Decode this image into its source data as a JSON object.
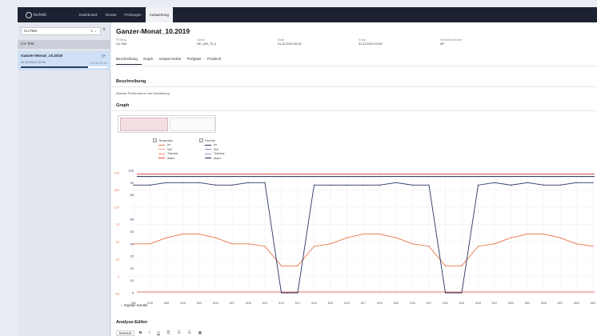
{
  "topbar": {
    "logo_text": "technik",
    "nav": [
      {
        "label": "Dashboard",
        "active": false
      },
      {
        "label": "Geräte",
        "active": false
      },
      {
        "label": "Prüfungen",
        "active": false
      },
      {
        "label": "Auswertung",
        "active": true
      }
    ]
  },
  "sidebar": {
    "select_value": "Co-Test",
    "group_label": "Co-Test",
    "item": {
      "title": "Ganzer-Monat_10.2019",
      "date": "01.10.2019, 00:00",
      "right_small": "540 Min 30 sec",
      "progress": 0.78
    }
  },
  "header": {
    "title": "Ganzer-Monat_10.2019",
    "meta": [
      {
        "label": "Prüfling",
        "value": "Co-Test"
      },
      {
        "label": "Gerät",
        "value": "DE_189_75_3"
      },
      {
        "label": "Start",
        "value": "01.10.2019 00:00"
      },
      {
        "label": "Ende",
        "value": "31.10.2019 23:59"
      },
      {
        "label": "Verantwortlicher",
        "value": "AP"
      }
    ],
    "tabs": [
      {
        "label": "Beschreibung",
        "active": true
      },
      {
        "label": "Graph",
        "active": false
      },
      {
        "label": "Analyse-Editor",
        "active": false
      },
      {
        "label": "Prüfgüter",
        "active": false
      },
      {
        "label": "Protokoll",
        "active": false
      }
    ]
  },
  "sections": {
    "beschreibung_title": "Beschreibung",
    "beschreibung_text": "Zwecks Performance und Darstellung",
    "graph_title": "Graph",
    "digital_label": "Digitale Kanäle",
    "editor_title": "Analyse-Editor"
  },
  "legend": {
    "temperature": {
      "title": "Temperatur",
      "items": [
        "Ist",
        "Soll",
        "Toleranz",
        "Alarm"
      ]
    },
    "humidity": {
      "title": "Feuchte",
      "items": [
        "Ist",
        "Soll",
        "Toleranz",
        "Alarm"
      ]
    }
  },
  "editor_toolbar": [
    "Normal",
    "B",
    "I",
    "U",
    "⎘",
    "☰",
    "☰",
    "▦"
  ],
  "colors": {
    "temperature": "#e8734a",
    "humidity": "#2a3563",
    "alarm_red": "#e04b3a",
    "alarm_navy": "#1d2a52",
    "nav_bg": "#1d2232"
  },
  "chart_data": {
    "type": "line",
    "x": [
      492,
      495,
      496,
      499,
      502,
      504,
      507,
      509,
      512,
      514,
      517,
      519,
      522,
      524,
      527,
      529,
      532,
      534,
      537,
      540,
      542,
      545,
      547,
      550,
      552,
      555,
      557,
      560,
      562
    ],
    "x_tick_labels": [
      "492",
      "495",
      "496",
      "499",
      "502",
      "504",
      "507",
      "509",
      "512",
      "514",
      "517",
      "519",
      "522",
      "524",
      "527",
      "529",
      "532",
      "534",
      "537",
      "540",
      "542",
      "545",
      "547",
      "550",
      "552",
      "555",
      "557",
      "560",
      "562"
    ],
    "y_left_ticks": [
      "175",
      "150",
      "125",
      "75",
      "45",
      "25",
      "0",
      "-45"
    ],
    "y_right_ticks": [
      "100",
      "90",
      "80",
      "60",
      "50",
      "40",
      "30",
      "20",
      "10",
      "0"
    ],
    "right_ylim": [
      0,
      100
    ],
    "series": [
      {
        "name": "Temperatur",
        "axis": "right",
        "values": [
          40,
          40,
          45,
          48,
          48,
          45,
          40,
          40,
          38,
          22,
          22,
          38,
          40,
          45,
          48,
          48,
          45,
          40,
          38,
          22,
          22,
          38,
          40,
          45,
          48,
          48,
          45,
          40,
          38
        ]
      },
      {
        "name": "Feuchte",
        "axis": "right",
        "values": [
          88,
          88,
          90,
          90,
          90,
          88,
          88,
          90,
          90,
          0,
          0,
          88,
          88,
          88,
          88,
          88,
          90,
          88,
          88,
          0,
          0,
          88,
          90,
          88,
          90,
          88,
          88,
          90,
          90
        ]
      }
    ],
    "alarm_lines_right": {
      "temperature": 97,
      "humidity": 95
    },
    "grid": true
  }
}
